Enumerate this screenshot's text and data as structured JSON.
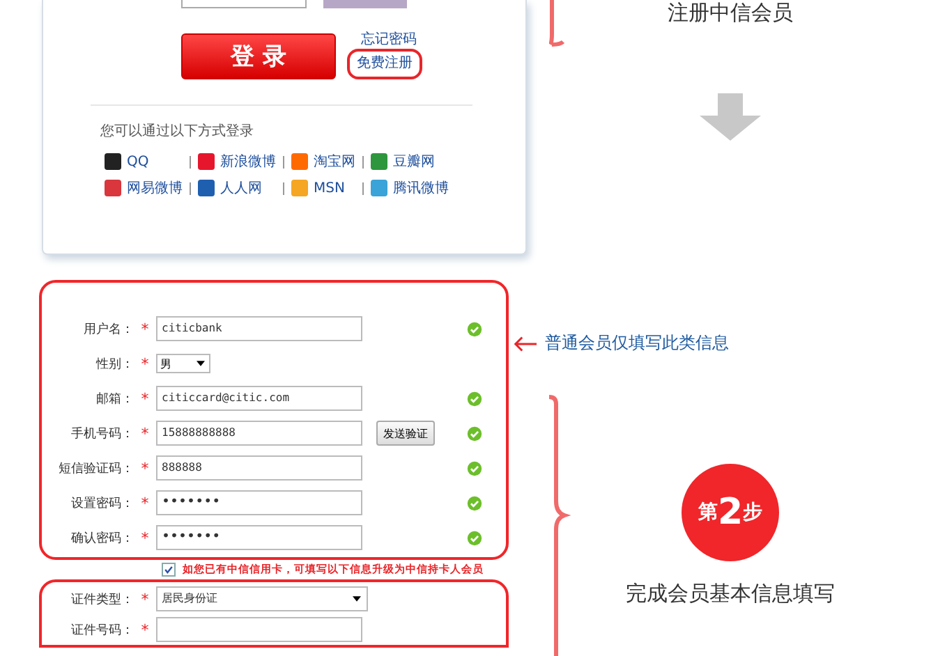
{
  "login_panel": {
    "login_button": "登 录",
    "forgot_password": "忘记密码",
    "register_link": "免费注册",
    "alt_login_prompt": "您可以通过以下方式登录",
    "providers": [
      {
        "label": "QQ",
        "color": "#222222"
      },
      {
        "label": "新浪微博",
        "color": "#e6162d"
      },
      {
        "label": "淘宝网",
        "color": "#ff6a00"
      },
      {
        "label": "豆瓣网",
        "color": "#2e963d"
      },
      {
        "label": "网易微博",
        "color": "#d9363e"
      },
      {
        "label": "人人网",
        "color": "#1f5fb0"
      },
      {
        "label": "MSN",
        "color": "#f5a623"
      },
      {
        "label": "腾讯微博",
        "color": "#3aa3d8"
      }
    ]
  },
  "step1_caption": "注册中信会员",
  "form": {
    "rows": [
      {
        "label": "用户名：",
        "mark": "*",
        "kind": "text",
        "value": "citicbank",
        "valid": true
      },
      {
        "label": "性别：",
        "mark": "*",
        "kind": "select",
        "value": "男",
        "valid": false
      },
      {
        "label": "邮箱：",
        "mark": "*",
        "kind": "text",
        "value": "citiccard@citic.com",
        "valid": true
      },
      {
        "label": "手机号码：",
        "mark": "*",
        "kind": "text",
        "value": "15888888888",
        "valid": true,
        "button": "发送验证"
      },
      {
        "label": "短信验证码：",
        "mark": "*",
        "kind": "text",
        "value": "888888",
        "valid": true
      },
      {
        "label": "设置密码：",
        "mark": "*",
        "kind": "password",
        "value": "•••••••",
        "valid": true
      },
      {
        "label": "确认密码：",
        "mark": "*",
        "kind": "password",
        "value": "•••••••",
        "valid": true
      }
    ],
    "upgrade_checkbox": {
      "checked": true,
      "label": "如您已有中信信用卡，可填写以下信息升级为中信持卡人会员"
    },
    "card_rows": [
      {
        "label": "证件类型：",
        "mark": "*",
        "kind": "wideselect",
        "value": "居民身份证"
      },
      {
        "label": "证件号码：",
        "mark": "*",
        "kind": "text",
        "value": ""
      }
    ]
  },
  "annotation": "普通会员仅填写此类信息",
  "step2": {
    "prefix": "第",
    "number": "2",
    "suffix": "步",
    "caption": "完成会员基本信息填写"
  }
}
